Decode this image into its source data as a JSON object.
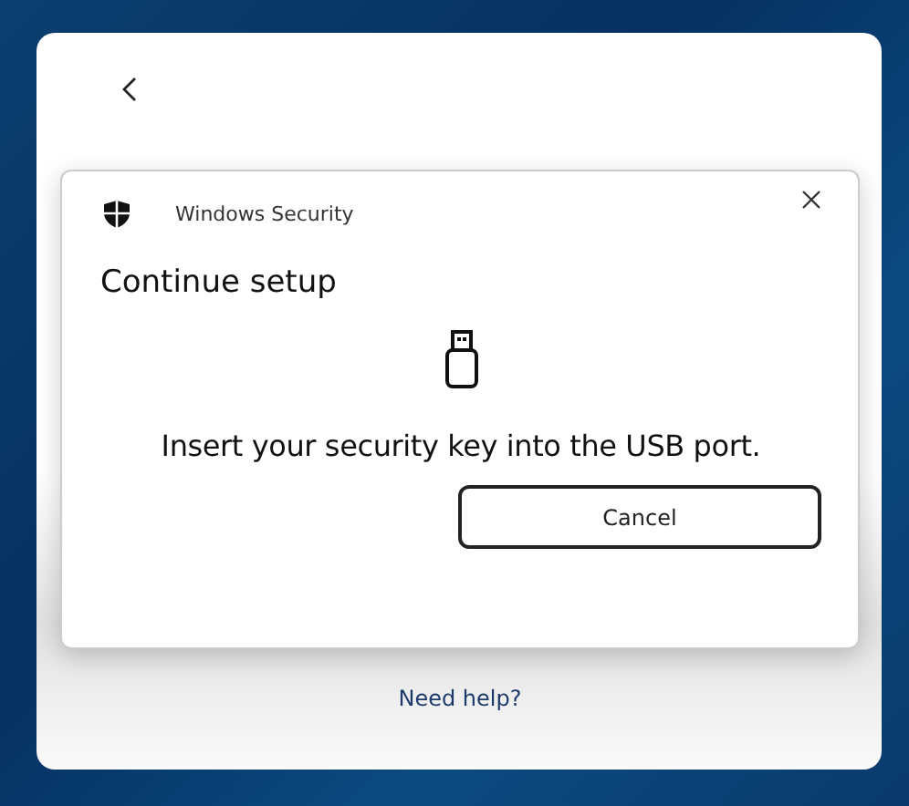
{
  "dialog": {
    "app_name": "Windows Security",
    "heading": "Continue setup",
    "message": "Insert your security key into the USB port.",
    "buttons": [
      "Cancel"
    ]
  },
  "help_link": "Need help?"
}
